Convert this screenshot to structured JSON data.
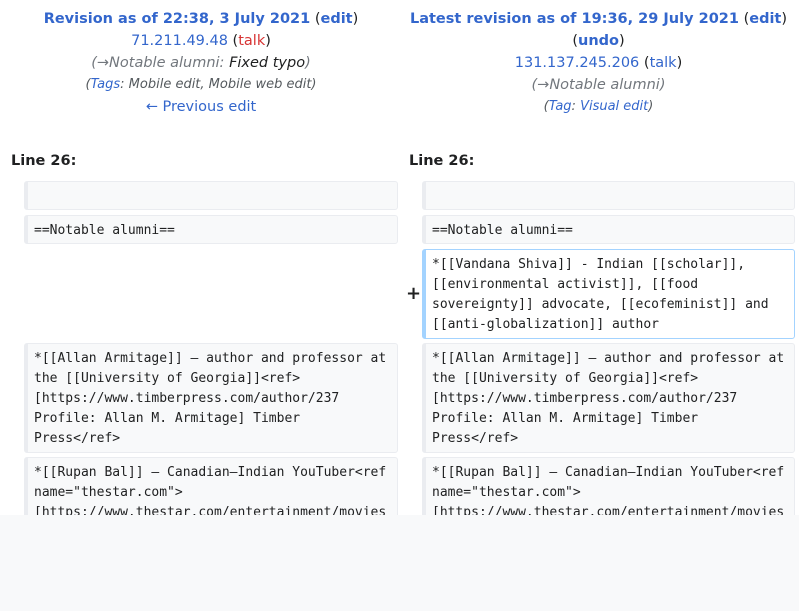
{
  "left": {
    "title": "Revision as of 22:38, 3 July 2021",
    "edit_label": "edit",
    "user": "71.211.49.48",
    "talk_label": "talk",
    "summary_link": "→Notable alumni:",
    "summary_text": "Fixed typo",
    "tags_label": "Tags",
    "tags_value": "Mobile edit, Mobile web edit",
    "prev_edit": "← Previous edit",
    "line_label": "Line 26:"
  },
  "right": {
    "title": "Latest revision as of 19:36, 29 July 2021",
    "edit_label": "edit",
    "undo_label": "undo",
    "user": "131.137.245.206",
    "talk_label": "talk",
    "summary_link": "→Notable alumni",
    "tags_label": "Tag",
    "tags_value": "Visual edit",
    "line_label": "Line 26:"
  },
  "diff": {
    "blank": "",
    "heading": "==Notable alumni==",
    "added_marker": "+",
    "added": "*[[Vandana Shiva]] - Indian [[scholar]], [[environmental activist]], [[food sovereignty]] advocate, [[ecofeminist]] and [[anti-globalization]] author",
    "armitage": "*[[Allan Armitage]] – author and professor at the [[University of Georgia]]<ref>[https://www.timberpress.com/author/237 Profile: Allan M. Armitage] Timber Press</ref>",
    "ball": "*[[Rupan Bal]] – Canadian–Indian YouTuber<ref name=\"thestar.com\">[https://www.thestar.com/entertainment/movies"
  }
}
